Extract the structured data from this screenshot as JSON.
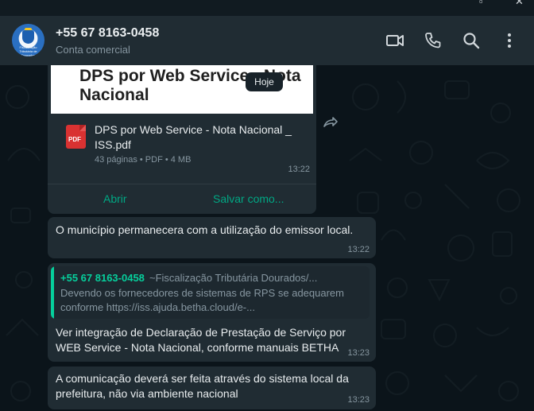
{
  "window": {
    "minimize_glyph": "▫",
    "close_glyph": "✕"
  },
  "header": {
    "contact_name": "+55 67 8163-0458",
    "contact_subtitle": "Conta comercial",
    "avatar_text": "Fiscalização Tributária de Dourados",
    "icons": [
      "video-call-icon",
      "voice-call-icon",
      "search-icon",
      "menu-dots-icon"
    ]
  },
  "chat": {
    "date_pill": "Hoje",
    "document": {
      "preview_title": "DPS por Web Service - Nota Nacional",
      "file_name": "DPS por Web Service - Nota Nacional _ ISS.pdf",
      "pdf_label": "PDF",
      "meta": "43 páginas • PDF • 4 MB",
      "time": "13:22",
      "open_label": "Abrir",
      "save_label": "Salvar como..."
    },
    "messages": [
      {
        "text": "O município permanecera com a utilização do emissor local.",
        "time": "13:22"
      },
      {
        "quote_author": "+55 67 8163-0458",
        "quote_group": "~Fiscalização Tributária Dourados/...",
        "quote_text": "Devendo os fornecedores de sistemas de RPS se adequarem conforme https://iss.ajuda.betha.cloud/e-...",
        "text": "Ver integração de Declaração de Prestação de Serviço por WEB Service - Nota Nacional, conforme manuais BETHA",
        "time": "13:23"
      },
      {
        "text": "A comunicação deverá ser feita através do sistema local da prefeitura, não via ambiente nacional",
        "time": "13:23"
      }
    ]
  },
  "colors": {
    "accent": "#00a884",
    "bubble": "#202c33",
    "background": "#0b141a",
    "quote_bar": "#06cf9c"
  }
}
